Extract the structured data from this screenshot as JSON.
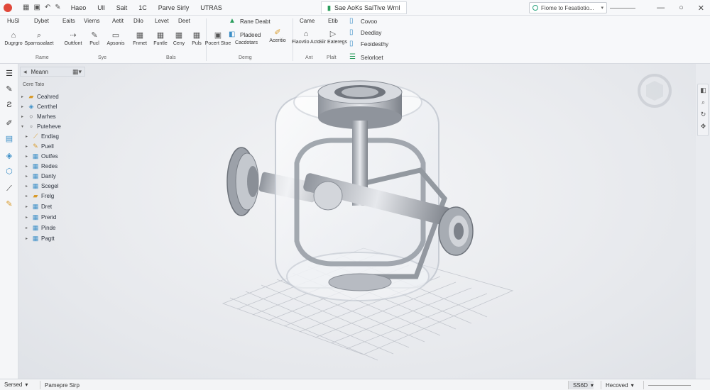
{
  "titlebar": {
    "menu": [
      "Haeo",
      "Ull",
      "Sait",
      "1C",
      "Parve Sirly",
      "UTRAS"
    ],
    "document_tab": "Sae AoKs SaiTive Wrnl",
    "search_text": "Fiome to Fesatiotio..."
  },
  "ribbon": {
    "tabs": [
      "HuSl",
      "Dybet",
      "Eaits",
      "Vierns",
      "Aetit",
      "Dilo",
      "Levet",
      "Deet",
      "Came",
      "Etib"
    ],
    "buttons": [
      {
        "label": "Dugrgro",
        "icon": "sketch-icon"
      },
      {
        "label": "Sparnsoalaet",
        "icon": "search-icon"
      },
      {
        "label": "Outtfont",
        "icon": "arrow-icon"
      },
      {
        "label": "Pucl",
        "icon": "pencil-icon"
      },
      {
        "label": "Apsonis",
        "icon": "rectangle-icon"
      },
      {
        "label": "Fnmet",
        "icon": "grid-icon"
      },
      {
        "label": "Funtle",
        "icon": "grid-icon"
      },
      {
        "label": "Ceny",
        "icon": "grid-icon"
      },
      {
        "label": "Puls",
        "icon": "grid-icon"
      },
      {
        "label": "Pocert Stoe",
        "icon": "frame-icon"
      },
      {
        "label": "Cacdotars",
        "icon": "frame-icon"
      },
      {
        "label": "Aceritio",
        "icon": "brush-icon"
      },
      {
        "label": "Fiaovtio Acto",
        "icon": "home-icon"
      },
      {
        "label": "Siir Eateregs",
        "icon": "play-icon"
      }
    ],
    "rows": [
      "Rane Deabt",
      "Pladeed",
      "Covoo",
      "Deedlay",
      "Feoidesthy",
      "Selorloet"
    ],
    "groups": [
      "Rame",
      "Sye",
      "Bals",
      "Demg",
      "Ant",
      "Plalt"
    ]
  },
  "tree": {
    "header_label": "Meann",
    "title": "Cere Tato",
    "items": [
      {
        "label": "Ceahred",
        "icon": "folder-icon",
        "color": "#d89a2a"
      },
      {
        "label": "Cerrthel",
        "icon": "cube-icon",
        "color": "#3c8fc7"
      },
      {
        "label": "Marhes",
        "icon": "circle-icon",
        "color": "#555555"
      },
      {
        "label": "Puteheve",
        "icon": "part-icon",
        "color": "#555555"
      },
      {
        "label": "Endlag",
        "icon": "sketch-icon",
        "color": "#d89a2a"
      },
      {
        "label": "Puell",
        "icon": "pencil-icon",
        "color": "#d89a2a"
      },
      {
        "label": "Outfes",
        "icon": "feature-icon",
        "color": "#3c8fc7"
      },
      {
        "label": "Redes",
        "icon": "feature-icon",
        "color": "#3c8fc7"
      },
      {
        "label": "Danty",
        "icon": "feature-icon",
        "color": "#3c8fc7"
      },
      {
        "label": "Scegel",
        "icon": "feature-icon",
        "color": "#3c8fc7"
      },
      {
        "label": "Frelg",
        "icon": "folder-icon",
        "color": "#d89a2a"
      },
      {
        "label": "Dret",
        "icon": "feature-icon",
        "color": "#3c8fc7"
      },
      {
        "label": "Prerid",
        "icon": "feature-icon",
        "color": "#3c8fc7"
      },
      {
        "label": "Pinde",
        "icon": "feature-icon",
        "color": "#3c8fc7"
      },
      {
        "label": "Pagtt",
        "icon": "feature-icon",
        "color": "#3c8fc7"
      }
    ]
  },
  "statusbar": {
    "left": "Sersed",
    "middle": "Pamepre Sirp",
    "right1": "SS6D",
    "right2": "Hecoved"
  },
  "colors": {
    "accent": "#2aa37f",
    "logo": "#e0483a"
  }
}
